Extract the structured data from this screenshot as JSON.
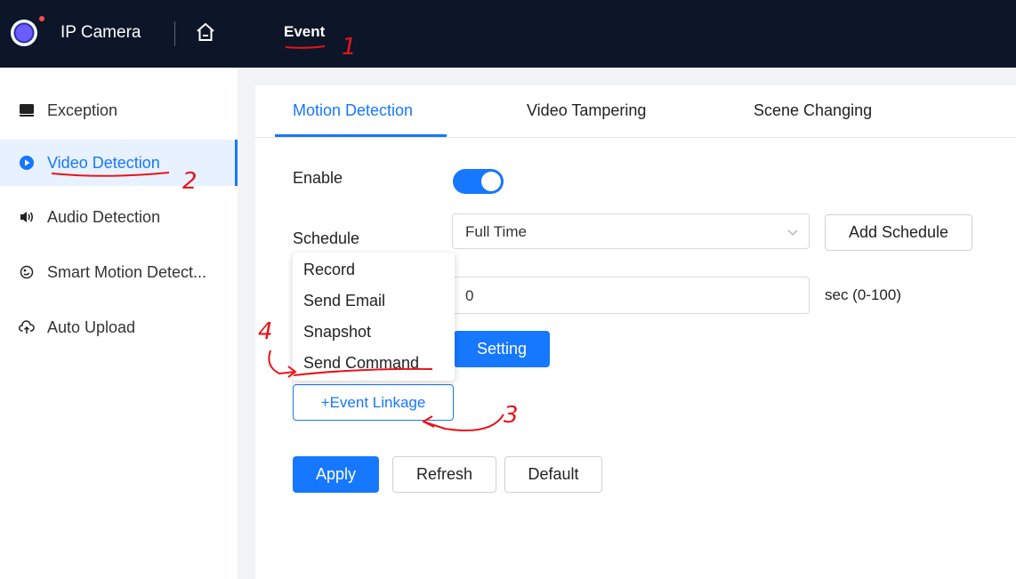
{
  "header": {
    "app_title": "IP Camera",
    "nav_event": "Event"
  },
  "sidebar": {
    "items": [
      {
        "label": "Exception",
        "icon": "monitor-icon",
        "active": false
      },
      {
        "label": "Video Detection",
        "icon": "play-circle-icon",
        "active": true
      },
      {
        "label": "Audio Detection",
        "icon": "speaker-icon",
        "active": false
      },
      {
        "label": "Smart Motion Detect...",
        "icon": "motion-icon",
        "active": false
      },
      {
        "label": "Auto Upload",
        "icon": "cloud-upload-icon",
        "active": false
      }
    ]
  },
  "tabs": [
    {
      "label": "Motion Detection",
      "active": true
    },
    {
      "label": "Video Tampering",
      "active": false
    },
    {
      "label": "Scene Changing",
      "active": false
    }
  ],
  "form": {
    "enable_label": "Enable",
    "enable_on": true,
    "schedule_label": "Schedule",
    "schedule_value": "Full Time",
    "add_schedule": "Add Schedule",
    "delay_value": "0",
    "delay_unit": "sec (0-100)",
    "setting_button": "Setting",
    "event_linkage_button": "+Event Linkage"
  },
  "linkage_menu": {
    "items": [
      "Record",
      "Send Email",
      "Snapshot",
      "Send Command"
    ]
  },
  "actions": {
    "apply": "Apply",
    "refresh": "Refresh",
    "default": "Default"
  },
  "annotations": [
    "1",
    "2",
    "3",
    "4"
  ],
  "colors": {
    "topbar": "#0c1628",
    "accent": "#1677ff",
    "annotation": "#e8141a"
  }
}
